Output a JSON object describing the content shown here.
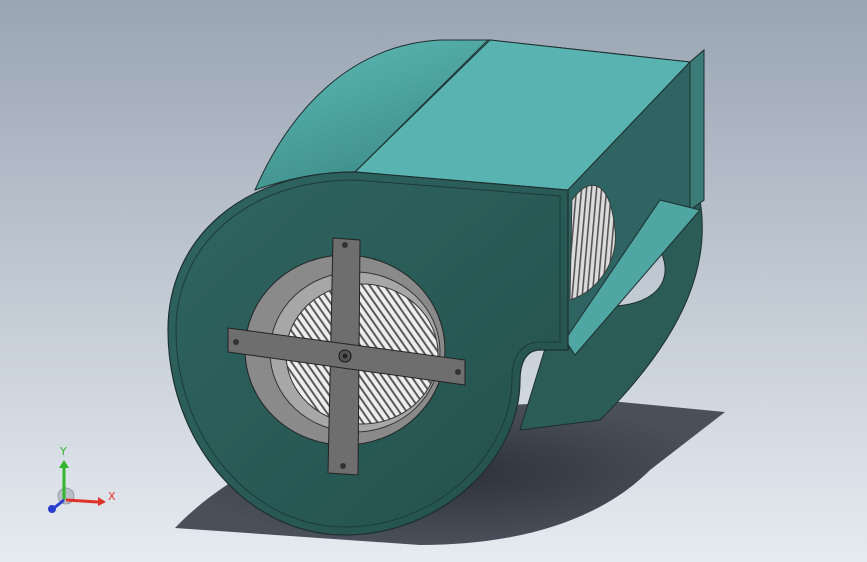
{
  "viewport": {
    "model_description_hidden": "",
    "colors": {
      "housing_light": "#55b0ae",
      "housing_dark": "#2b5c58",
      "housing_face": "#2a5a56",
      "outline": "#1e2f2f",
      "bracket": "#6e6e6e",
      "shadow": "#3b3f48",
      "background_top": "#9aa5b3",
      "background_bottom": "#e6ebf0"
    }
  },
  "triad": {
    "x_label": "X",
    "y_label": "Y",
    "x_color": "#e0322a",
    "y_color": "#33b52e",
    "z_color": "#2a3fd0"
  }
}
